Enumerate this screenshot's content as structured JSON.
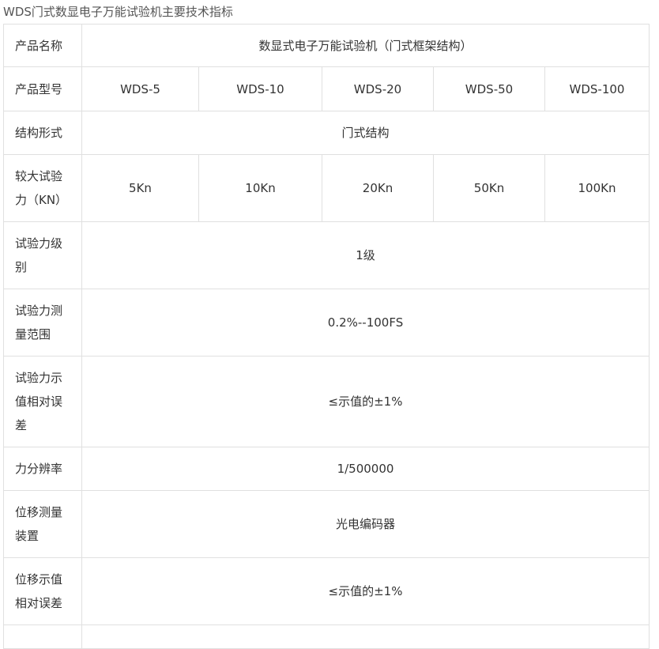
{
  "title": "WDS门式数显电子万能试验机主要技术指标",
  "rows": [
    {
      "label": "产品名称",
      "value": "数显式电子万能试验机（门式框架结构）"
    },
    {
      "label": "产品型号",
      "cells": [
        "WDS-5",
        "WDS-10",
        "WDS-20",
        "WDS-50",
        "WDS-100"
      ]
    },
    {
      "label": "结构形式",
      "value": "门式结构"
    },
    {
      "label": "较大试验力（KN）",
      "cells": [
        "5Kn",
        "10Kn",
        "20Kn",
        "50Kn",
        "100Kn"
      ]
    },
    {
      "label": "试验力级别",
      "value": "1级"
    },
    {
      "label": "试验力测量范围",
      "value": "0.2%--100FS"
    },
    {
      "label": "试验力示值相对误差",
      "value": "≤示值的±1%"
    },
    {
      "label": "力分辨率",
      "value": "1/500000"
    },
    {
      "label": "位移测量装置",
      "value": "光电编码器"
    },
    {
      "label": "位移示值相对误差",
      "value": "≤示值的±1%"
    }
  ]
}
